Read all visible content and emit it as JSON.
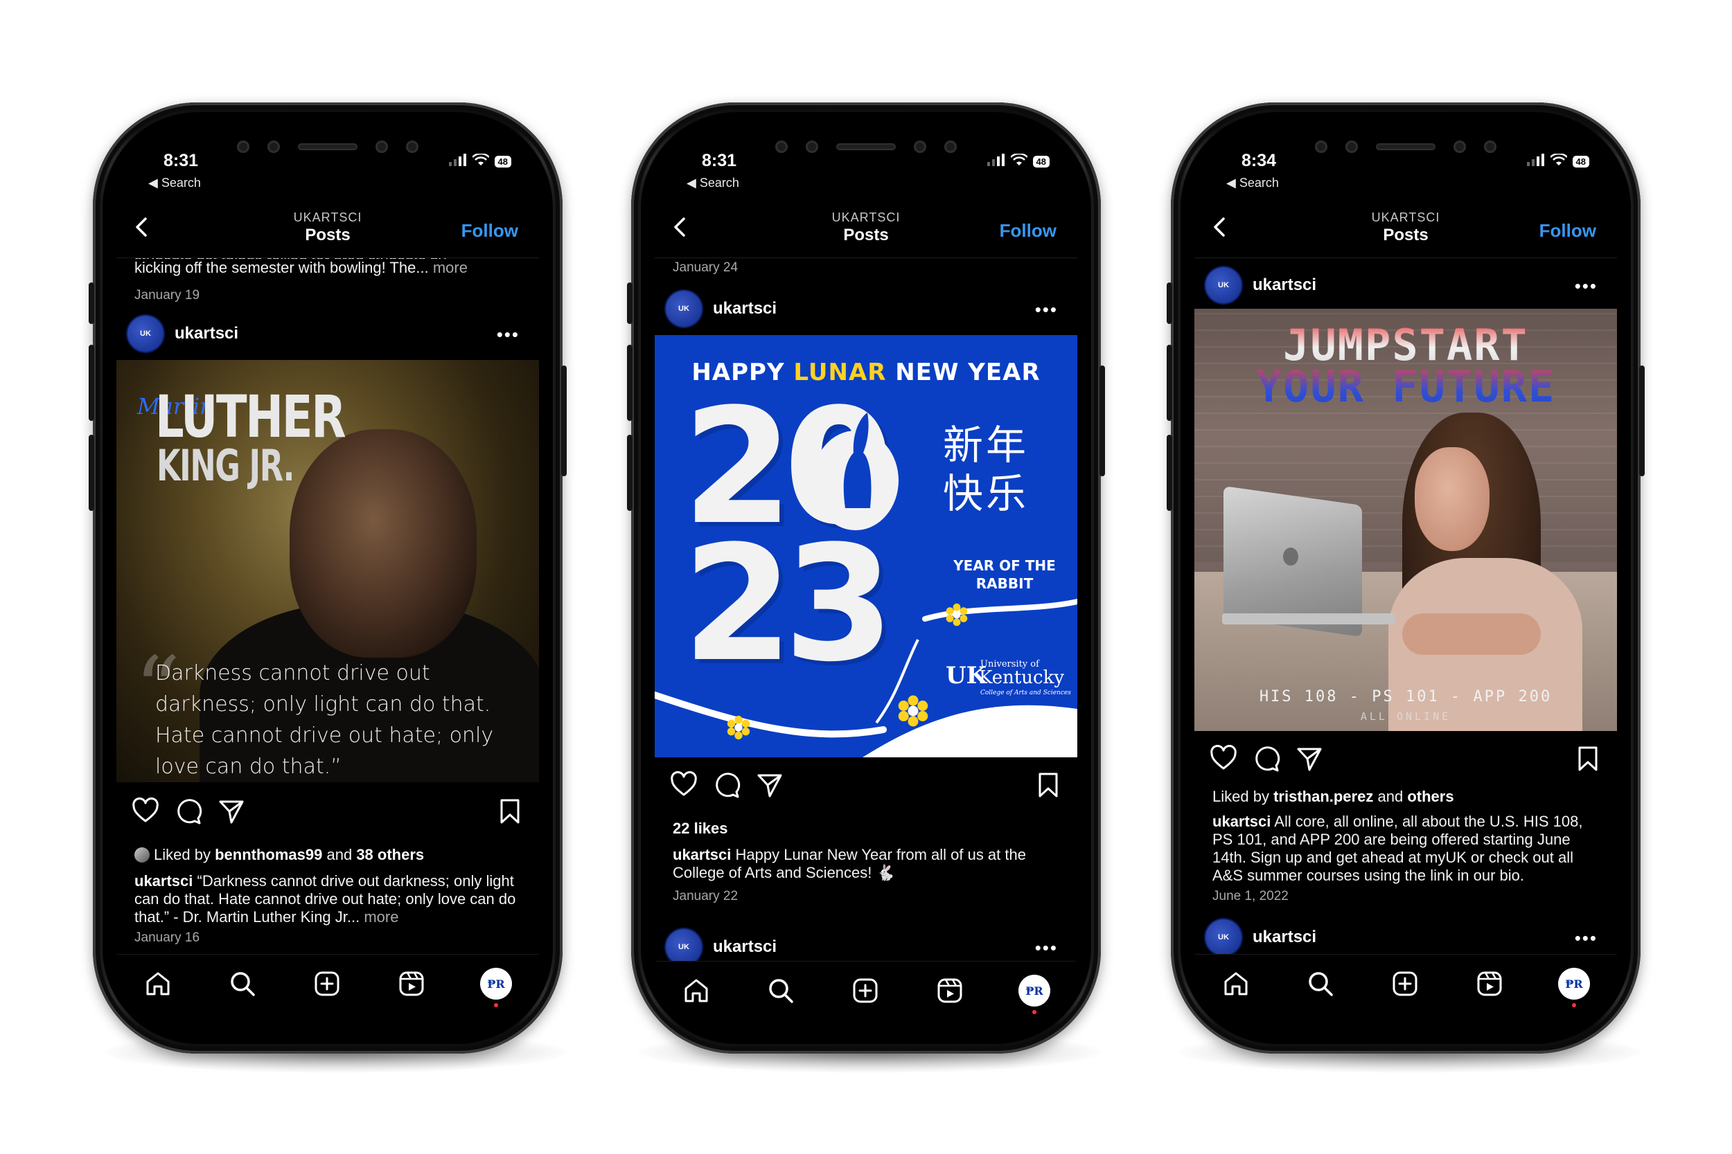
{
  "phones": [
    {
      "status": {
        "time": "8:31",
        "back_label": "◀ Search",
        "battery": "48"
      },
      "header": {
        "account": "UKARTSCI",
        "title": "Posts",
        "follow": "Follow"
      },
      "prev_post": {
        "caption_line1": "students got things rolling for grad students by",
        "caption_line2": "kicking off the semester with bowling! The...",
        "more": "more",
        "date": "January 19"
      },
      "post": {
        "username": "ukartsci",
        "avatar_label": "UK",
        "image": {
          "title_script": "Martin",
          "title_line1": "LUTHER",
          "title_line2": "KING JR.",
          "quote_mark": "“",
          "quote": "Darkness cannot drive out darkness; only light can do that. Hate cannot drive out hate; only love can do that.”"
        },
        "liked_by_prefix": "Liked by",
        "liked_by_user": "bennthomas99",
        "liked_by_suffix": "and",
        "liked_by_others": "38 others",
        "caption_user": "ukartsci",
        "caption_text": "“Darkness cannot drive out darkness; only light can do that. Hate cannot drive out hate; only love can do that.” - Dr. Martin Luther King Jr...",
        "more": "more",
        "date": "January 16"
      }
    },
    {
      "status": {
        "time": "8:31",
        "back_label": "◀ Search",
        "battery": "48"
      },
      "header": {
        "account": "UKARTSCI",
        "title": "Posts",
        "follow": "Follow"
      },
      "prev_post": {
        "date": "January 24"
      },
      "post": {
        "username": "ukartsci",
        "avatar_label": "UK",
        "image": {
          "headline_a": "HAPPY ",
          "headline_b": "LUNAR",
          "headline_c": " NEW YEAR",
          "year_top": "20",
          "year_bottom": "23",
          "chinese_line1": "新年",
          "chinese_line2": "快乐",
          "year_of": "YEAR OF THE RABBIT",
          "logo_uk": "UK",
          "logo_university": "University of",
          "logo_kentucky": "Kentucky",
          "logo_college": "College of Arts and Sciences"
        },
        "likes": "22 likes",
        "caption_user": "ukartsci",
        "caption_text": "Happy Lunar New Year from all of us at the College of Arts and Sciences! 🐇",
        "date": "January 22"
      },
      "next_post": {
        "username": "ukartsci",
        "avatar_label": "UK"
      }
    },
    {
      "status": {
        "time": "8:34",
        "back_label": "◀ Search",
        "battery": "48"
      },
      "header": {
        "account": "UKARTSCI",
        "title": "Posts",
        "follow": "Follow"
      },
      "post": {
        "username": "ukartsci",
        "avatar_label": "UK",
        "image": {
          "title_line1": "JUMPSTART",
          "title_line2": "YOUR FUTURE",
          "courses": "HIS 108 - PS 101 - APP 200",
          "online": "ALL ONLINE"
        },
        "liked_by_prefix": "Liked by",
        "liked_by_user": "tristhan.perez",
        "liked_by_suffix": "and",
        "liked_by_others": "others",
        "caption_user": "ukartsci",
        "caption_text": "All core, all online, all about the U.S. HIS 108, PS 101, and APP 200 are being offered starting June 14th. Sign up and get ahead at myUK or check out all A&S summer courses using the link in our bio.",
        "date": "June 1, 2022"
      },
      "next_post": {
        "username": "ukartsci",
        "avatar_label": "UK"
      }
    }
  ],
  "icons": [
    "chevron-left-icon",
    "more-dots-icon",
    "heart-icon",
    "comment-icon",
    "share-icon",
    "bookmark-icon",
    "home-icon",
    "search-icon",
    "create-icon",
    "reels-icon",
    "profile-icon",
    "wifi-icon",
    "signal-icon",
    "battery-icon"
  ],
  "colors": {
    "follow_blue": "#3797f0",
    "lunar_blue": "#0a3fc4",
    "lunar_yellow": "#ffd21f",
    "notification_red": "#ff3040"
  }
}
